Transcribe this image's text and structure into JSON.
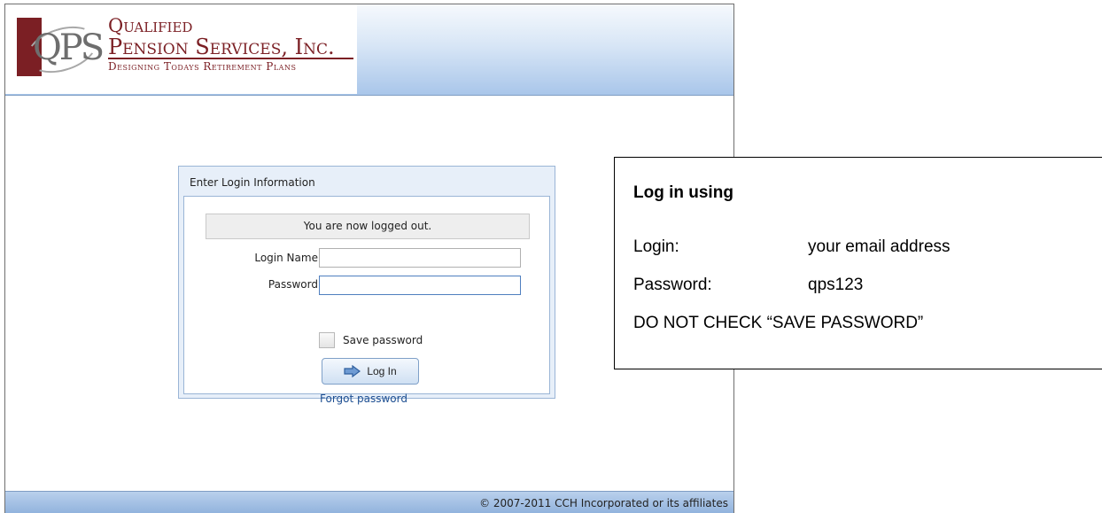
{
  "brand": {
    "monogram": "QPS",
    "line1": "Qualified",
    "line2": "Pension Services, Inc.",
    "line3": "Designing Todays Retirement Plans",
    "maroon": "#7b1f24"
  },
  "login": {
    "panel_title": "Enter Login Information",
    "status_message": "You are now logged out.",
    "login_name_label": "Login Name:",
    "login_name_value": "",
    "password_label": "Password:",
    "password_value": "",
    "save_password_label": "Save password",
    "save_password_checked": false,
    "login_button_label": "Log In",
    "login_button_icon": "arrow-right-icon",
    "forgot_password_link": "Forgot password"
  },
  "footer": {
    "copyright": "© 2007-2011 CCH Incorporated or its affiliates"
  },
  "callout": {
    "title": "Log in using",
    "login_label": "Login:",
    "login_value": "your email address",
    "password_label": "Password:",
    "password_value": "qps123",
    "note": "DO NOT CHECK “SAVE PASSWORD”"
  }
}
